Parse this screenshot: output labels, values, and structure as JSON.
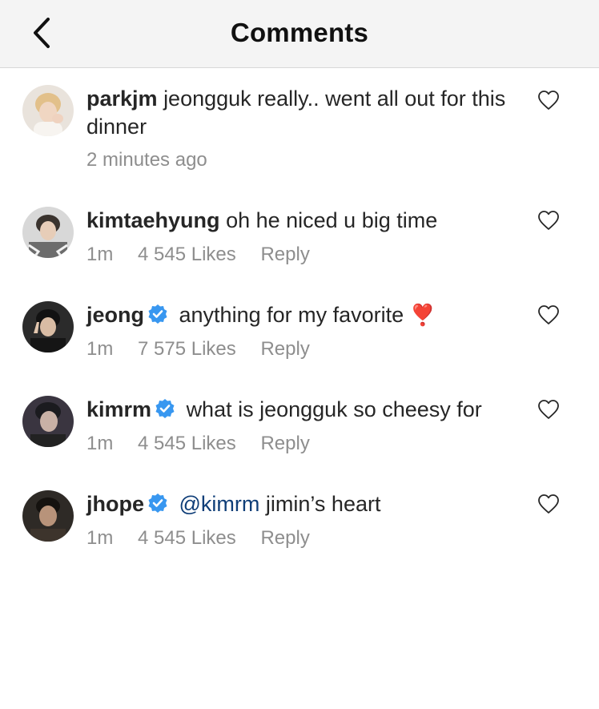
{
  "header": {
    "title": "Comments",
    "back_icon": "chevron-left-icon"
  },
  "comments": [
    {
      "username": "parkjm",
      "verified": false,
      "text": "jeongguk really.. went all out for this dinner",
      "time": "2 minutes ago",
      "likes": "",
      "reply": ""
    },
    {
      "username": "kimtaehyung",
      "verified": false,
      "text": "oh he niced u big time",
      "time": "1m",
      "likes": "4 545 Likes",
      "reply": "Reply"
    },
    {
      "username": "jeong",
      "verified": true,
      "text": "anything for my favorite",
      "emoji": "❣️",
      "time": "1m",
      "likes": "7 575 Likes",
      "reply": "Reply"
    },
    {
      "username": "kimrm",
      "verified": true,
      "text": "what is jeongguk so cheesy for",
      "time": "1m",
      "likes": "4 545 Likes",
      "reply": "Reply"
    },
    {
      "username": "jhope",
      "verified": true,
      "mention": "@kimrm",
      "text": "jimin’s heart",
      "time": "1m",
      "likes": "4 545 Likes",
      "reply": "Reply"
    }
  ],
  "colors": {
    "verified": "#3897f0",
    "mention": "#0f3e78",
    "meta": "#8e8e8e"
  }
}
